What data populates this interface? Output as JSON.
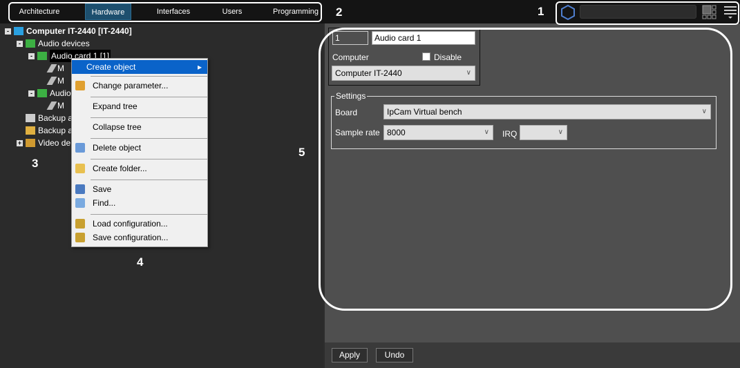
{
  "tabs": [
    {
      "label": "Architecture"
    },
    {
      "label": "Hardware",
      "active": true
    },
    {
      "label": "Interfaces"
    },
    {
      "label": "Users"
    },
    {
      "label": "Programming"
    }
  ],
  "header": {
    "logo_icon": "hexagon-icon",
    "search_value": "",
    "layout_icon": "layout-grid-icon",
    "menu_icon": "hamburger-menu-icon"
  },
  "tree": [
    {
      "label": "Computer IT-2440 [IT-2440]",
      "level": 0,
      "expander": "-",
      "icon": "computer-icon"
    },
    {
      "label": "Audio devices",
      "level": 1,
      "expander": "-",
      "icon": "audio-board-icon"
    },
    {
      "label": "Audio card 1 [1]",
      "level": 2,
      "expander": "-",
      "icon": "audio-board-icon",
      "selected": true
    },
    {
      "label": "M",
      "level": 3,
      "icon": "microphone-icon"
    },
    {
      "label": "M",
      "level": 3,
      "icon": "microphone-icon"
    },
    {
      "label": "Audio",
      "level": 2,
      "expander": "-",
      "icon": "audio-board-icon"
    },
    {
      "label": "M",
      "level": 3,
      "icon": "microphone-icon"
    },
    {
      "label": "Backup a",
      "level": 1,
      "icon": "archive-icon"
    },
    {
      "label": "Backup a",
      "level": 1,
      "icon": "backup-icon"
    },
    {
      "label": "Video de",
      "level": 1,
      "expander": "+",
      "icon": "video-device-icon"
    }
  ],
  "context_menu": [
    {
      "label": "Create object",
      "highlighted": true,
      "submenu": true
    },
    {
      "label": "Change parameter...",
      "icon": "key-icon"
    },
    {
      "label": "Expand tree"
    },
    {
      "label": "Collapse tree"
    },
    {
      "label": "Delete object",
      "icon": "recycle-bin-icon"
    },
    {
      "label": "Create folder...",
      "icon": "new-folder-icon"
    },
    {
      "label": "Save",
      "icon": "save-icon"
    },
    {
      "label": "Find...",
      "icon": "magnifier-icon"
    },
    {
      "label": "Load configuration...",
      "icon": "box-icon"
    },
    {
      "label": "Save configuration...",
      "icon": "box-icon"
    }
  ],
  "form": {
    "id_value": "1",
    "name_value": "Audio card 1",
    "computer_label": "Computer",
    "disable_label": "Disable",
    "disable_checked": false,
    "computer_value": "Computer IT-2440",
    "settings_legend": "Settings",
    "board_label": "Board",
    "board_value": "IpCam Virtual bench",
    "sample_rate_label": "Sample rate",
    "sample_rate_value": "8000",
    "irq_label": "IRQ",
    "irq_value": ""
  },
  "buttons": {
    "apply": "Apply",
    "undo": "Undo"
  },
  "annotations": [
    "1",
    "2",
    "3",
    "4",
    "5"
  ]
}
